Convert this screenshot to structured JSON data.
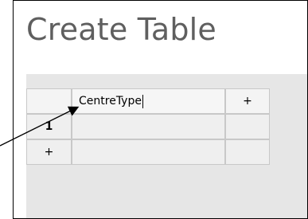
{
  "page": {
    "title": "Create Table"
  },
  "table_editor": {
    "corner": "",
    "column_name_value": "CentreType",
    "add_column_label": "+",
    "row_number": "1",
    "add_row_label": "+"
  },
  "colors": {
    "title_text": "#5f5f5f",
    "grid_background": "#e6e6e6",
    "cell_border": "#c8c8c8",
    "frame_border": "#000000"
  }
}
